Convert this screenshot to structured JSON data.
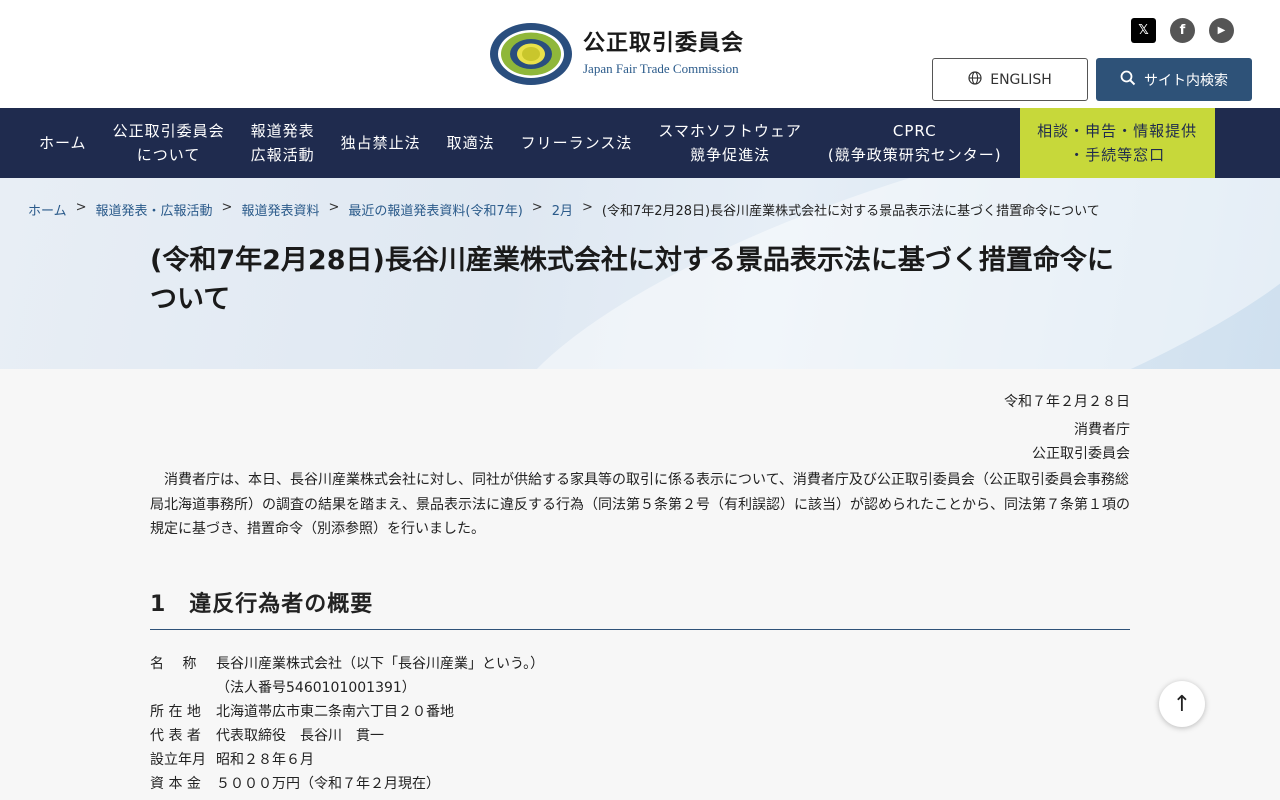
{
  "header": {
    "org_name_ja": "公正取引委員会",
    "org_name_en": "Japan Fair Trade Commission",
    "logo_ring_text": "JAPAN FAIR TRADE COMMISSION",
    "social": [
      {
        "name": "x-icon",
        "glyph": "𝕏"
      },
      {
        "name": "facebook-icon",
        "glyph": "f"
      },
      {
        "name": "youtube-icon",
        "glyph": "▶"
      }
    ],
    "english_label": "ENGLISH",
    "search_label": "サイト内検索"
  },
  "nav": {
    "items": [
      {
        "label_1": "ホーム",
        "label_2": ""
      },
      {
        "label_1": "公正取引委員会",
        "label_2": "について"
      },
      {
        "label_1": "報道発表",
        "label_2": "広報活動"
      },
      {
        "label_1": "独占禁止法",
        "label_2": ""
      },
      {
        "label_1": "取適法",
        "label_2": ""
      },
      {
        "label_1": "フリーランス法",
        "label_2": ""
      },
      {
        "label_1": "スマホソフトウェア",
        "label_2": "競争促進法"
      },
      {
        "label_1": "CPRC",
        "label_2": "(競争政策研究センター)"
      }
    ],
    "cta": {
      "label_1": "相談・申告・情報提供",
      "label_2": "・手続等窓口"
    }
  },
  "breadcrumb": {
    "links": [
      "ホーム",
      "報道発表・広報活動",
      "報道発表資料",
      "最近の報道発表資料(令和7年)",
      "2月"
    ],
    "current": "(令和7年2月28日)長谷川産業株式会社に対する景品表示法に基づく措置命令について"
  },
  "page_title": "(令和7年2月28日)長谷川産業株式会社に対する景品表示法に基づく措置命令について",
  "content": {
    "date": "令和７年２月２８日",
    "issuer_1": "消費者庁",
    "issuer_2": "公正取引委員会",
    "paragraph": "消費者庁は、本日、長谷川産業株式会社に対し、同社が供給する家具等の取引に係る表示について、消費者庁及び公正取引委員会（公正取引委員会事務総局北海道事務所）の調査の結果を踏まえ、景品表示法に違反する行為（同法第５条第２号（有利誤認）に該当）が認められたことから、同法第７条第１項の規定に基づき、措置命令（別添参照）を行いました。",
    "section_1_heading": "1　違反行為者の概要",
    "info": [
      {
        "label": "名　 称",
        "value": "長谷川産業株式会社（以下「長谷川産業」という。）"
      },
      {
        "label": "",
        "value": "（法人番号5460101001391）"
      },
      {
        "label": "所 在 地",
        "value": "北海道帯広市東二条南六丁目２０番地"
      },
      {
        "label": "代 表 者",
        "value": "代表取締役　長谷川　貫一"
      },
      {
        "label": "設立年月",
        "value": "昭和２８年６月"
      },
      {
        "label": "資 本 金",
        "value": "５０００万円（令和７年２月現在）"
      }
    ]
  },
  "back_to_top_glyph": "↑",
  "colors": {
    "nav_bg": "#1f2b4e",
    "cta_bg": "#c7d83a",
    "search_bg": "#2e5278",
    "link": "#2a5a8a"
  }
}
